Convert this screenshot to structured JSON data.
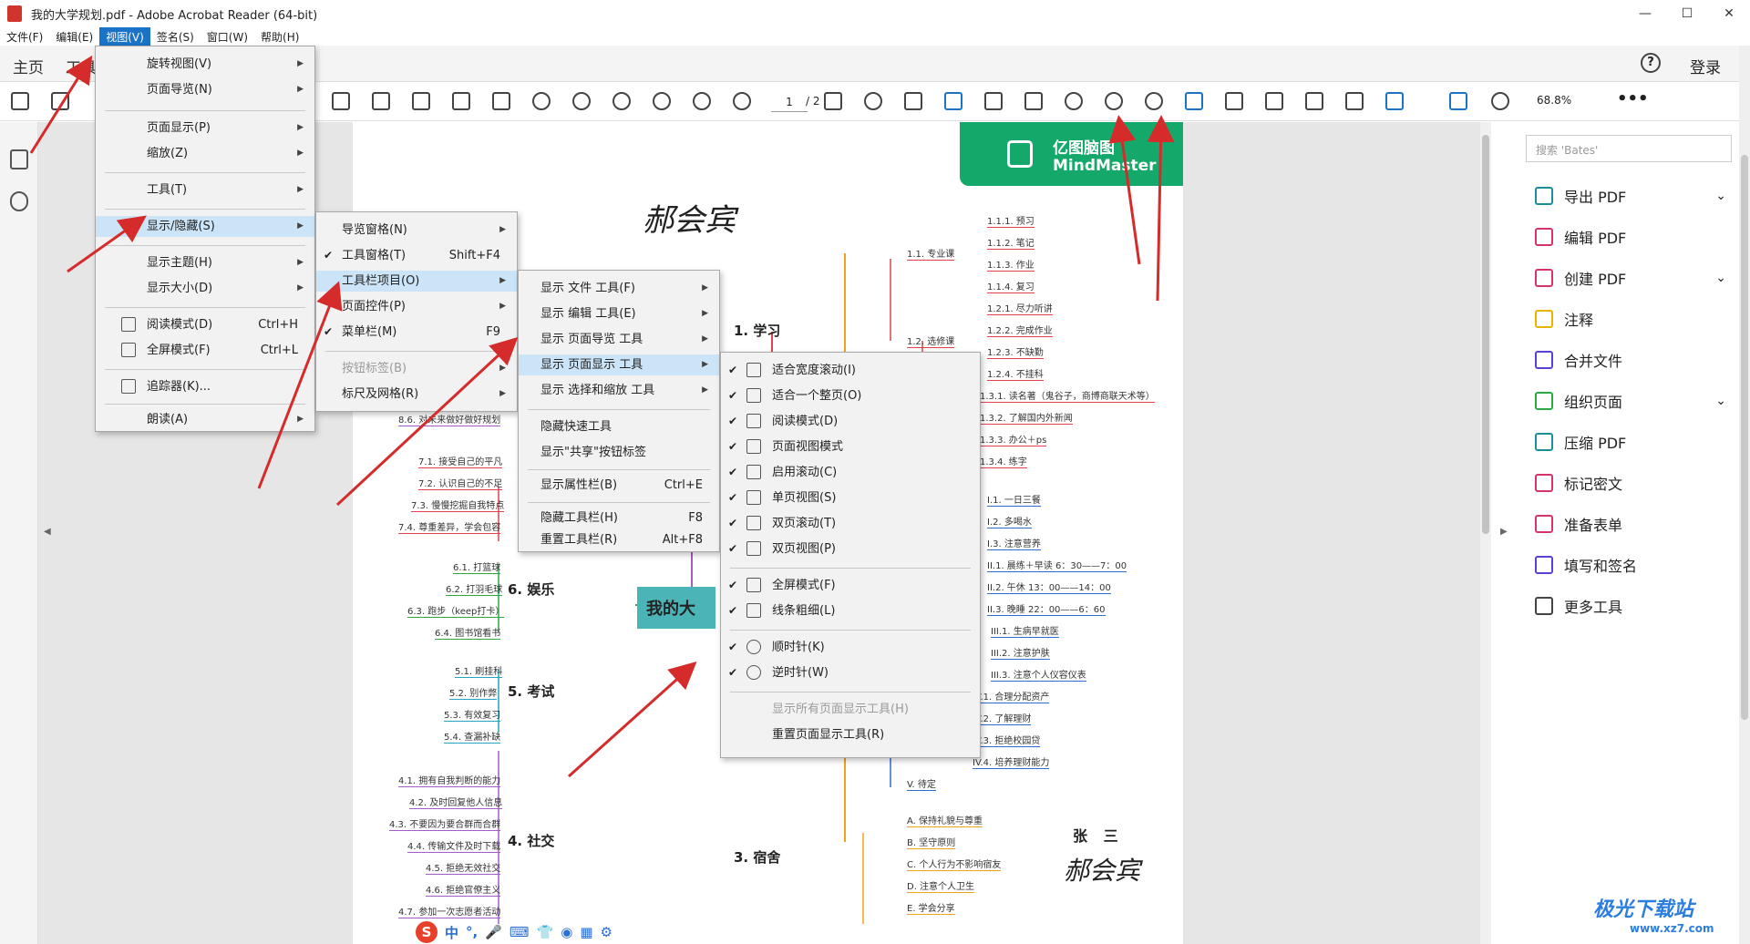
{
  "window": {
    "title": "我的大学规划.pdf - Adobe Acrobat Reader (64-bit)",
    "minimize": "—",
    "maximize": "☐",
    "close": "✕"
  },
  "menubar": [
    "文件(F)",
    "编辑(E)",
    "视图(V)",
    "签名(S)",
    "窗口(W)",
    "帮助(H)"
  ],
  "tabs": {
    "home": "主页",
    "tools": "工具",
    "help": "?",
    "login": "登录"
  },
  "toolbar": {
    "page_current": "1",
    "page_total": "/ 2",
    "zoom": "68.8%",
    "more": "•••"
  },
  "view_menu": {
    "items": [
      {
        "label": "旋转视图(V)",
        "arrow": "▶"
      },
      {
        "label": "页面导览(N)",
        "arrow": "▶"
      },
      {
        "label": "页面显示(P)",
        "arrow": "▶"
      },
      {
        "label": "缩放(Z)",
        "arrow": "▶"
      },
      {
        "label": "工具(T)",
        "arrow": "▶"
      },
      {
        "label": "显示/隐藏(S)",
        "arrow": "▶"
      },
      {
        "label": "显示主题(H)",
        "arrow": "▶"
      },
      {
        "label": "显示大小(D)",
        "arrow": "▶"
      },
      {
        "label": "阅读模式(D)",
        "shortcut": "Ctrl+H"
      },
      {
        "label": "全屏模式(F)",
        "shortcut": "Ctrl+L"
      },
      {
        "label": "追踪器(K)..."
      },
      {
        "label": "朗读(A)",
        "arrow": "▶"
      }
    ]
  },
  "showhide_menu": {
    "items": [
      {
        "label": "导览窗格(N)",
        "arrow": "▶"
      },
      {
        "label": "工具窗格(T)",
        "shortcut": "Shift+F4",
        "check": "✔"
      },
      {
        "label": "工具栏项目(O)",
        "arrow": "▶"
      },
      {
        "label": "页面控件(P)",
        "arrow": "▶"
      },
      {
        "label": "菜单栏(M)",
        "shortcut": "F9",
        "check": "✔"
      },
      {
        "label": "按钮标签(B)",
        "arrow": "▶"
      },
      {
        "label": "标尺及网格(R)",
        "arrow": "▶"
      }
    ]
  },
  "toolbar_items_menu": {
    "items": [
      {
        "label": "显示 文件 工具(F)",
        "arrow": "▶"
      },
      {
        "label": "显示 编辑 工具(E)",
        "arrow": "▶"
      },
      {
        "label": "显示 页面导览 工具",
        "arrow": "▶"
      },
      {
        "label": "显示 页面显示 工具",
        "arrow": "▶"
      },
      {
        "label": "显示 选择和缩放 工具",
        "arrow": "▶"
      },
      {
        "label": "隐藏快速工具"
      },
      {
        "label": "显示\"共享\"按钮标签"
      },
      {
        "label": "显示属性栏(B)",
        "shortcut": "Ctrl+E"
      },
      {
        "label": "隐藏工具栏(H)",
        "shortcut": "F8"
      },
      {
        "label": "重置工具栏(R)",
        "shortcut": "Alt+F8"
      }
    ]
  },
  "page_display_menu": {
    "items": [
      {
        "label": "适合宽度滚动(I)",
        "check": "✔"
      },
      {
        "label": "适合一个整页(O)",
        "check": "✔"
      },
      {
        "label": "阅读模式(D)",
        "check": "✔"
      },
      {
        "label": "页面视图模式",
        "check": "✔"
      },
      {
        "label": "启用滚动(C)",
        "check": "✔"
      },
      {
        "label": "单页视图(S)",
        "check": "✔"
      },
      {
        "label": "双页滚动(T)",
        "check": "✔"
      },
      {
        "label": "双页视图(P)",
        "check": "✔"
      },
      {
        "label": "全屏模式(F)",
        "check": "✔"
      },
      {
        "label": "线条粗细(L)",
        "check": "✔"
      },
      {
        "label": "顺时针(K)",
        "check": "✔"
      },
      {
        "label": "逆时针(W)",
        "check": "✔"
      },
      {
        "label": "显示所有页面显示工具(H)"
      },
      {
        "label": "重置页面显示工具(R)"
      }
    ]
  },
  "document": {
    "brand_line1": "亿图脑图",
    "brand_line2": "MindMaster",
    "signature": "郝会宾",
    "center": "我的大",
    "name_bottom": "张 三",
    "branches": [
      "1. 学习",
      "6. 娱乐",
      "5. 考试",
      "4. 社交",
      "3. 宿舍"
    ],
    "nodes_right": [
      "1.1.1. 预习",
      "1.1.2. 笔记",
      "1.1.3. 作业",
      "1.1.4. 复习",
      "1.1. 专业课",
      "1.2.1. 尽力听讲",
      "1.2. 选修课",
      "1.2.2. 完成作业",
      "1.2.3. 不缺勤",
      "1.2.4. 不挂科",
      "1.3.1. 读名著（鬼谷子，商博商联天术等）",
      "1.3.2. 了解国内外新闻",
      "1.3.3. 办公＋ps",
      "1.3.4. 练字",
      "I.1. 一日三餐",
      "I.2. 多喝水",
      "I.3. 注意营养",
      "II.1. 晨练＋早读 6：30——7：00",
      "II.2. 午休 13：00——14：00",
      "II.3. 晚睡 22：00——6：60",
      "III.1. 生病早就医",
      "III.2. 注意护肤",
      "III.3. 注意个人仪容仪表",
      "IV.1. 合理分配资产",
      "IV.2. 了解理财",
      "IV.3. 拒绝校园贷",
      "IV.4. 培养理财能力",
      "V. 待定",
      "A. 保持礼貌与尊重",
      "B. 坚守原则",
      "C. 个人行为不影响宿友",
      "D. 注意个人卫生",
      "E. 学会分享"
    ],
    "nodes_left": [
      "8.6. 对未来做好做好规划",
      "7.1. 接受自己的平凡",
      "7.2. 认识自己的不足",
      "7.3. 慢慢挖掘自我特点",
      "7.4. 尊重差异，学会包容",
      "6.1. 打篮球",
      "6.2. 打羽毛球",
      "6.3. 跑步（keep打卡）",
      "6.4. 图书馆看书",
      "5.1. 刷挂科",
      "5.2. 别作弊",
      "5.3. 有效复习",
      "5.4. 查漏补缺",
      "4.1. 拥有自我判断的能力",
      "4.2. 及时回复他人信息",
      "4.3. 不要因为要合群而合群",
      "4.4. 传输文件及时下载",
      "4.5. 拒绝无效社交",
      "4.6. 拒绝官僚主义",
      "4.7. 参加一次志愿者活动"
    ],
    "ime": [
      "S",
      "中",
      "°,",
      "🎤",
      "⌨",
      "👕",
      "◉",
      "▦",
      "⚙"
    ]
  },
  "right_panel": {
    "search_placeholder": "搜索 'Bates'",
    "items": [
      {
        "label": "导出 PDF",
        "color": "#1a8f9a",
        "chev": "⌄"
      },
      {
        "label": "编辑 PDF",
        "color": "#d6336c"
      },
      {
        "label": "创建 PDF",
        "color": "#d6336c",
        "chev": "⌄"
      },
      {
        "label": "注释",
        "color": "#e8b400"
      },
      {
        "label": "合并文件",
        "color": "#5b3fd6"
      },
      {
        "label": "组织页面",
        "color": "#2aa844",
        "chev": "⌄"
      },
      {
        "label": "压缩 PDF",
        "color": "#1a8f9a"
      },
      {
        "label": "标记密文",
        "color": "#d6336c"
      },
      {
        "label": "准备表单",
        "color": "#d6336c"
      },
      {
        "label": "填写和签名",
        "color": "#5b3fd6"
      },
      {
        "label": "更多工具",
        "color": "#444"
      }
    ]
  },
  "watermark": {
    "main": "极光下载站",
    "url": "www.xz7.com"
  },
  "colors": {
    "menu_highlight": "#cce4f7",
    "accent": "#1a73c6",
    "arrow": "#d62b2b",
    "brand": "#14a86b"
  }
}
